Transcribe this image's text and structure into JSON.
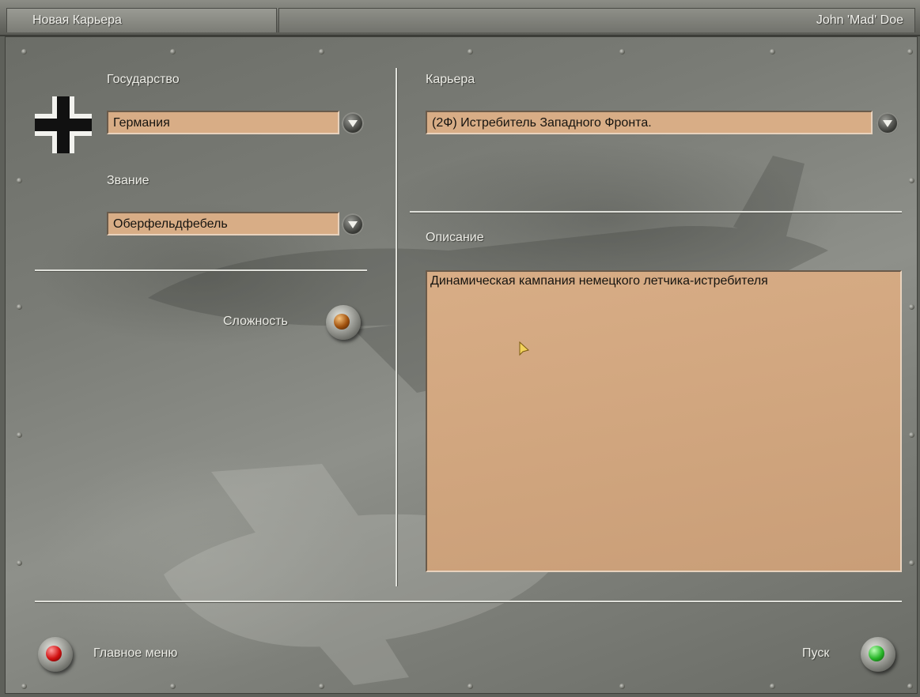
{
  "window": {
    "title": "Новая Карьера",
    "player_name": "John 'Mad' Doe"
  },
  "country": {
    "label": "Государство",
    "value": "Германия",
    "insignia_icon": "balkenkreuz-icon"
  },
  "rank": {
    "label": "Звание",
    "value": "Оберфельдфебель"
  },
  "difficulty": {
    "label": "Сложность"
  },
  "career": {
    "label": "Карьера",
    "value": "(2Ф) Истребитель Западного Фронта."
  },
  "description": {
    "label": "Описание",
    "text": "Динамическая кампания немецкого летчика-истребителя"
  },
  "footer": {
    "main_menu_label": "Главное меню",
    "start_label": "Пуск"
  },
  "colors": {
    "field_bg": "#d8ad86",
    "panel_metal": "#7a7c76",
    "main_menu_lamp": "#d01010",
    "start_lamp": "#27b528",
    "difficulty_lamp": "#a0510e"
  }
}
